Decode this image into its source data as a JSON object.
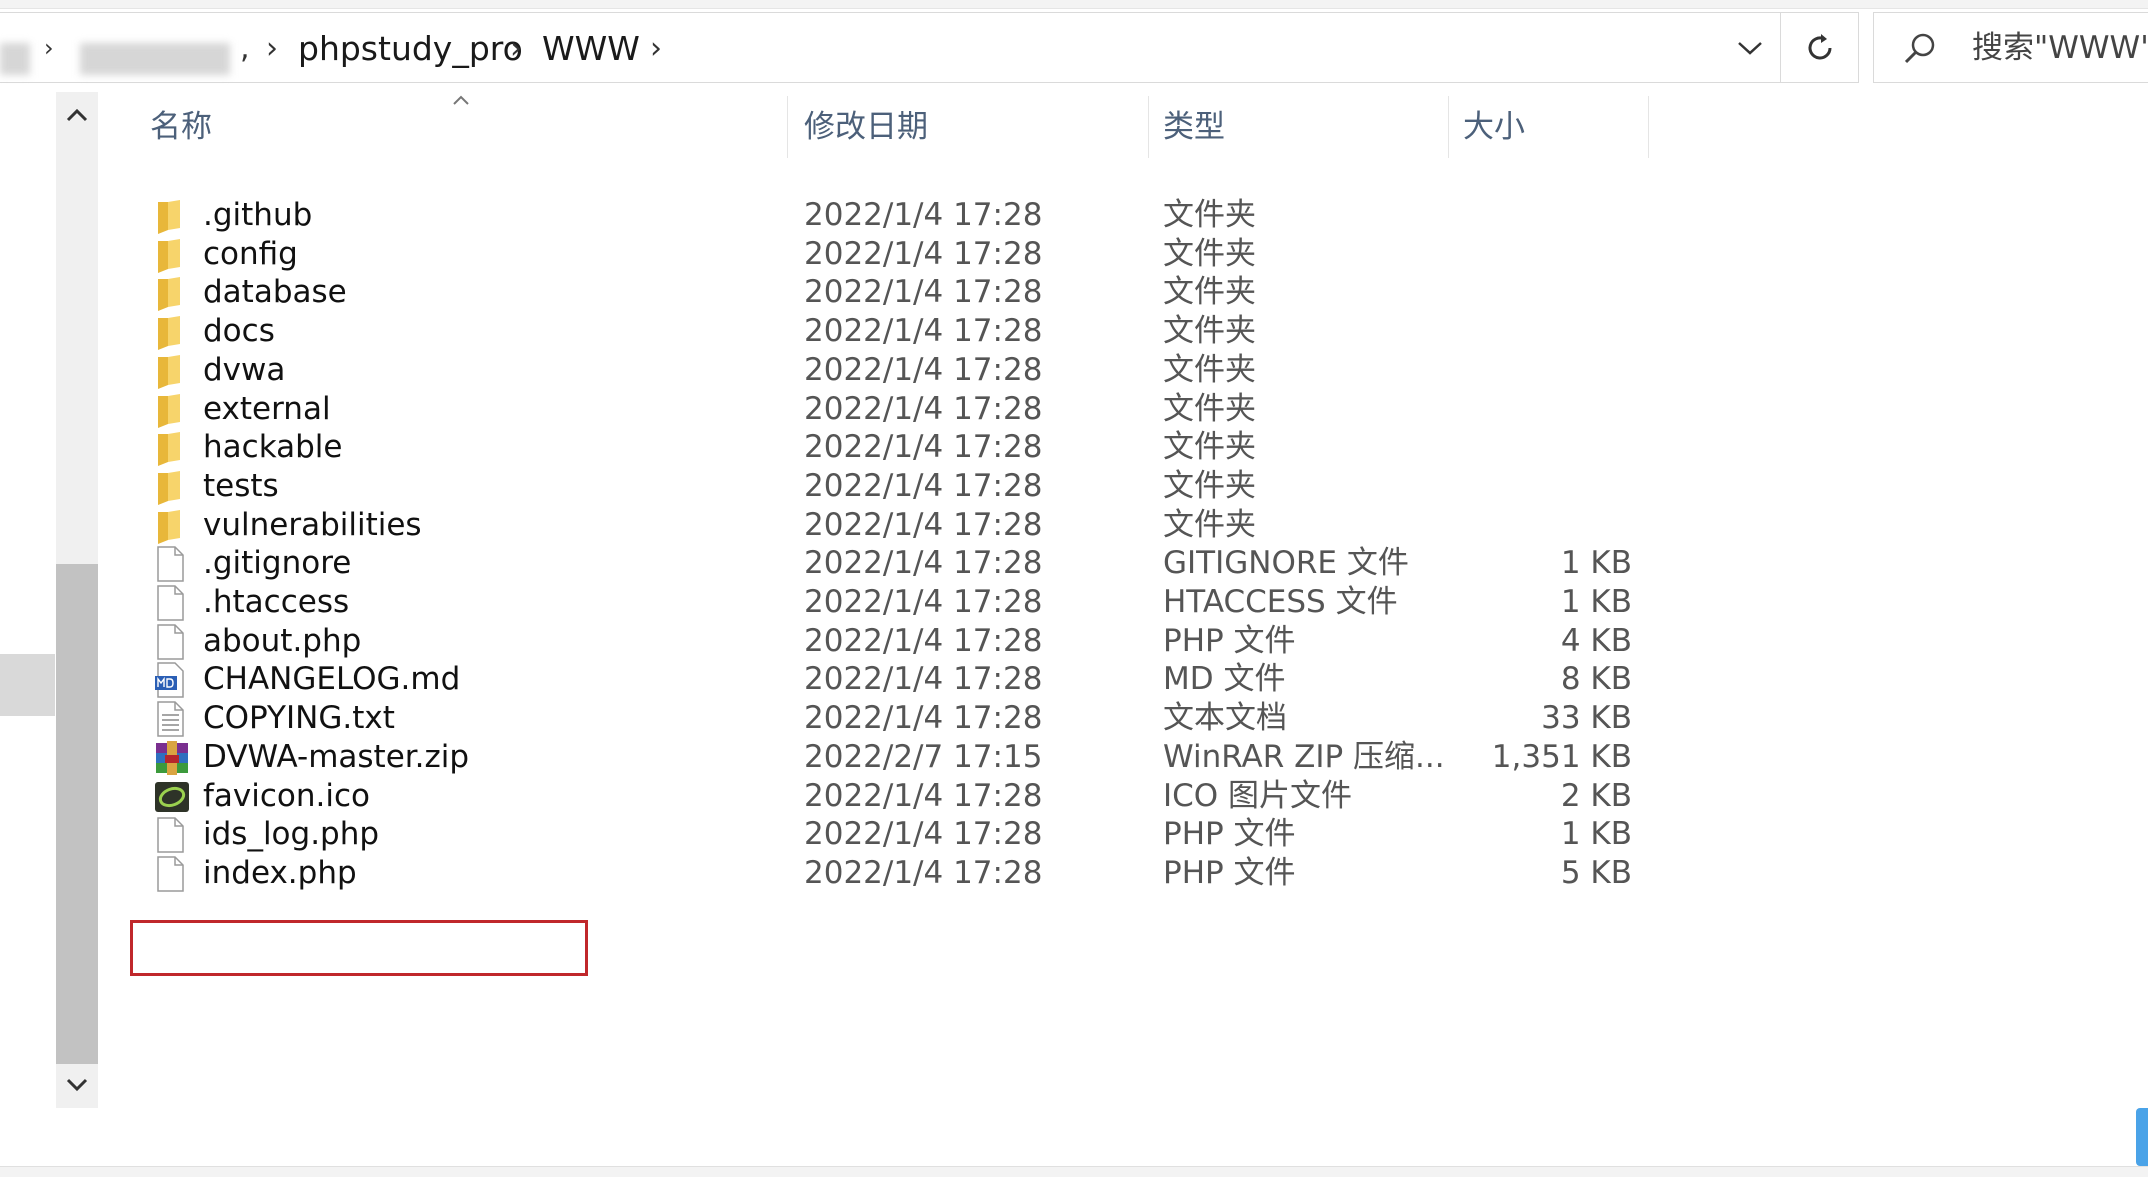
{
  "address": {
    "crumbs": [
      "phpstudy_pro",
      "WWW"
    ],
    "search_placeholder": "搜索\"WWW\""
  },
  "columns": {
    "name": "名称",
    "date": "修改日期",
    "type": "类型",
    "size": "大小"
  },
  "files": [
    {
      "name": ".github",
      "date": "2022/1/4 17:28",
      "type": "文件夹",
      "size": "",
      "icon": "folder-icon"
    },
    {
      "name": "config",
      "date": "2022/1/4 17:28",
      "type": "文件夹",
      "size": "",
      "icon": "folder-icon"
    },
    {
      "name": "database",
      "date": "2022/1/4 17:28",
      "type": "文件夹",
      "size": "",
      "icon": "folder-icon"
    },
    {
      "name": "docs",
      "date": "2022/1/4 17:28",
      "type": "文件夹",
      "size": "",
      "icon": "folder-icon"
    },
    {
      "name": "dvwa",
      "date": "2022/1/4 17:28",
      "type": "文件夹",
      "size": "",
      "icon": "folder-icon"
    },
    {
      "name": "external",
      "date": "2022/1/4 17:28",
      "type": "文件夹",
      "size": "",
      "icon": "folder-icon"
    },
    {
      "name": "hackable",
      "date": "2022/1/4 17:28",
      "type": "文件夹",
      "size": "",
      "icon": "folder-icon"
    },
    {
      "name": "tests",
      "date": "2022/1/4 17:28",
      "type": "文件夹",
      "size": "",
      "icon": "folder-icon"
    },
    {
      "name": "vulnerabilities",
      "date": "2022/1/4 17:28",
      "type": "文件夹",
      "size": "",
      "icon": "folder-icon"
    },
    {
      "name": ".gitignore",
      "date": "2022/1/4 17:28",
      "type": "GITIGNORE 文件",
      "size": "1 KB",
      "icon": "file-icon"
    },
    {
      "name": ".htaccess",
      "date": "2022/1/4 17:28",
      "type": "HTACCESS 文件",
      "size": "1 KB",
      "icon": "file-icon"
    },
    {
      "name": "about.php",
      "date": "2022/1/4 17:28",
      "type": "PHP 文件",
      "size": "4 KB",
      "icon": "file-icon"
    },
    {
      "name": "CHANGELOG.md",
      "date": "2022/1/4 17:28",
      "type": "MD 文件",
      "size": "8 KB",
      "icon": "markdown-file-icon"
    },
    {
      "name": "COPYING.txt",
      "date": "2022/1/4 17:28",
      "type": "文本文档",
      "size": "33 KB",
      "icon": "text-file-icon"
    },
    {
      "name": "DVWA-master.zip",
      "date": "2022/2/7 17:15",
      "type": "WinRAR ZIP 压缩...",
      "size": "1,351 KB",
      "icon": "winrar-archive-icon"
    },
    {
      "name": "favicon.ico",
      "date": "2022/1/4 17:28",
      "type": "ICO 图片文件",
      "size": "2 KB",
      "icon": "ico-image-icon"
    },
    {
      "name": "ids_log.php",
      "date": "2022/1/4 17:28",
      "type": "PHP 文件",
      "size": "1 KB",
      "icon": "file-icon"
    },
    {
      "name": "index.php",
      "date": "2022/1/4 17:28",
      "type": "PHP 文件",
      "size": "5 KB",
      "icon": "file-icon"
    }
  ],
  "colors": {
    "highlight_border": "#c0282b",
    "folder": "#f2c94c",
    "header_text": "#4c607a"
  }
}
